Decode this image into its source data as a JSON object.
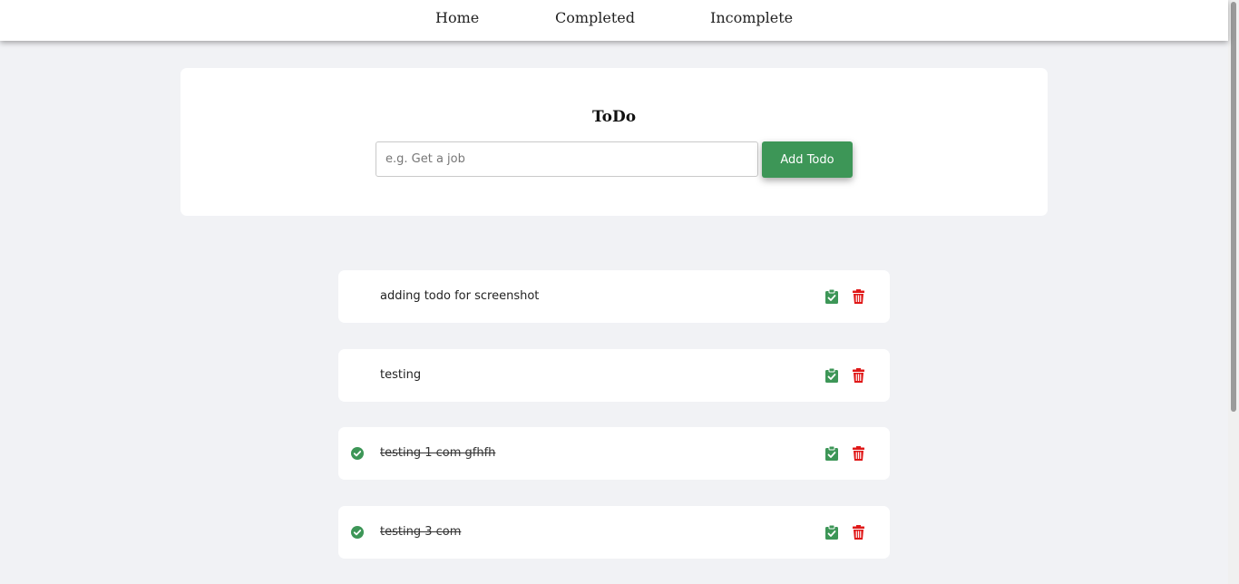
{
  "nav": {
    "items": [
      {
        "label": "Home"
      },
      {
        "label": "Completed"
      },
      {
        "label": "Incomplete"
      }
    ]
  },
  "form": {
    "title": "ToDo",
    "input_placeholder": "e.g. Get a job",
    "input_value": "",
    "add_button_label": "Add Todo"
  },
  "todos": [
    {
      "text": "adding todo for screenshot",
      "completed": false
    },
    {
      "text": "testing",
      "completed": false
    },
    {
      "text": "testing 1 com gfhfh",
      "completed": true
    },
    {
      "text": "testing 3 com",
      "completed": true
    }
  ],
  "icons": {
    "check": "check-circle-icon",
    "complete": "clipboard-check-icon",
    "delete": "trash-icon"
  },
  "colors": {
    "accent_green": "#3d9657",
    "delete_red": "#e01818",
    "background": "#f1f2f5"
  }
}
